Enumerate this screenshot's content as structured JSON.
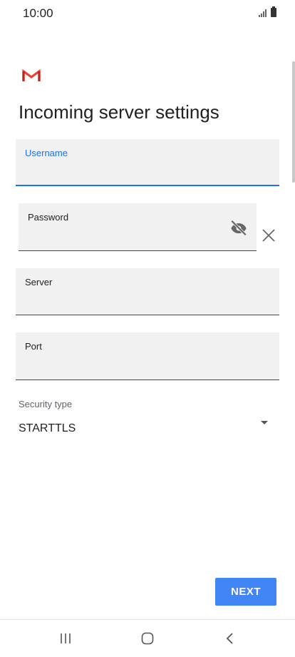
{
  "status_bar": {
    "time": "10:00",
    "signal_icon": "signal-icon",
    "battery_icon": "battery-icon"
  },
  "app": {
    "logo_icon": "gmail-logo-icon",
    "title": "Incoming server settings"
  },
  "form": {
    "username": {
      "label": "Username",
      "value": "",
      "active": true
    },
    "password": {
      "label": "Password",
      "value": "",
      "visibility_icon": "visibility-off-icon",
      "clear_icon": "close-icon"
    },
    "server": {
      "label": "Server",
      "value": ""
    },
    "port": {
      "label": "Port",
      "value": ""
    },
    "security_type": {
      "label": "Security type",
      "selected": "STARTTLS"
    }
  },
  "actions": {
    "next_label": "NEXT"
  },
  "nav_bar": {
    "recents_icon": "recents-icon",
    "home_icon": "home-icon",
    "back_icon": "back-icon"
  },
  "colors": {
    "accent": "#1a73e8",
    "button": "#4285f4",
    "gmail_red": "#ea4335",
    "field_bg": "#f1f1f1"
  }
}
